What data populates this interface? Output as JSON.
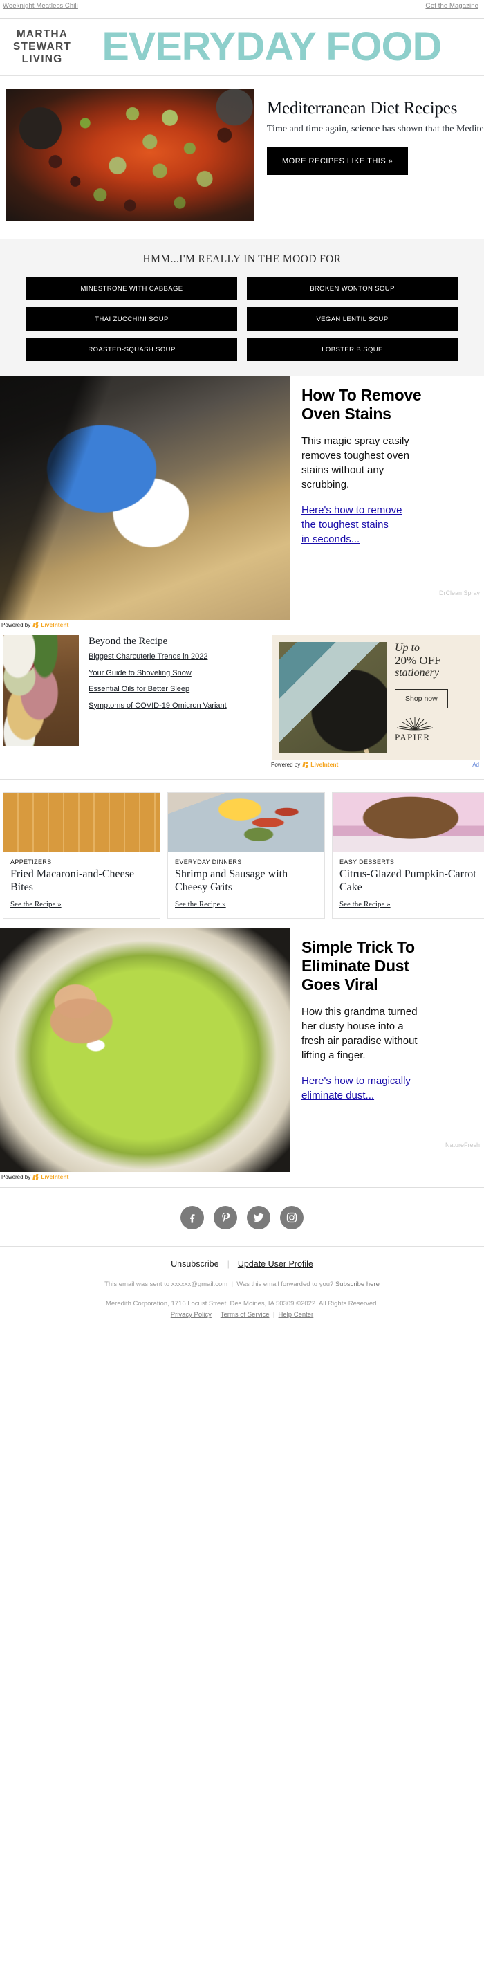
{
  "preheader": {
    "left_link": "Weeknight Meatless Chili",
    "right_link": "Get the Magazine"
  },
  "masthead": {
    "brand_line1": "MARTHA",
    "brand_line2": "STEWART",
    "brand_line3": "LIVING",
    "publication": "EVERYDAY FOOD",
    "accent_color": "#8ecfcb"
  },
  "hero": {
    "title": "Mediterranean Diet Recipes",
    "body": "Time and time again, science has shown that the Mediterranean diet promotes anti-aging and healthy bodies and minds.",
    "cta": "MORE RECIPES LIKE THIS »",
    "image_alt": "Bowl of black bean chili with avocado and cilantro"
  },
  "mood": {
    "heading": "HMM...I'M REALLY IN THE MOOD FOR",
    "buttons": [
      "MINESTRONE WITH CABBAGE",
      "BROKEN WONTON SOUP",
      "THAI ZUCCHINI SOUP",
      "VEGAN LENTIL SOUP",
      "ROASTED-SQUASH SOUP",
      "LOBSTER BISQUE"
    ]
  },
  "sponsored_oven": {
    "title_line1": "How To Remove",
    "title_line2": "Oven Stains",
    "body_line1": "This magic spray easily",
    "body_line2": "removes toughest oven",
    "body_line3": "stains without any",
    "body_line4": "scrubbing.",
    "link_line1": "Here's how to remove",
    "link_line2": "the toughest stains",
    "link_line3": "in seconds...",
    "advertiser": "DrClean Spray",
    "powered_by": "Powered by",
    "network": "LiveIntent",
    "image_alt": "Blue-gloved hand scrubbing an oven with a pink sponge",
    "link_color": "#1a0dab"
  },
  "beyond_recipe": {
    "title": "Beyond the Recipe",
    "links": [
      "Biggest Charcuterie Trends in 2022",
      "Your Guide to Shoveling Snow",
      "Essential Oils for Better Sleep",
      "Symptoms of COVID-19 Omicron Variant"
    ],
    "image_alt": "Charcuterie board with cheese, meats, olives and rosemary"
  },
  "papier_ad": {
    "headline_line1": "Up to",
    "headline_line2": "20% OFF",
    "headline_line3": "stationery",
    "button": "Shop now",
    "brand": "PAPIER",
    "powered_by": "Powered by",
    "network": "LiveIntent",
    "ad_mark": "Ad",
    "image_alt": "Notebooks and pencil on an olive green desk",
    "bg_color": "#f3ece0"
  },
  "recipe_cards": [
    {
      "category": "APPETIZERS",
      "title": "Fried Macaroni-and-Cheese Bites",
      "link": "See the Recipe »",
      "image_alt": "Grid of golden fried macaroni and cheese bites"
    },
    {
      "category": "EVERYDAY DINNERS",
      "title": "Shrimp and Sausage with Cheesy Grits",
      "link": "See the Recipe »",
      "image_alt": "Bowl of shrimp and sausage over cheesy grits"
    },
    {
      "category": "EASY DESSERTS",
      "title": "Citrus-Glazed Pumpkin-Carrot Cake",
      "link": "See the Recipe »",
      "image_alt": "Glazed pumpkin carrot bundt cake on a pink stand"
    }
  ],
  "sponsored_dust": {
    "title_line1": "Simple Trick To",
    "title_line2": "Eliminate Dust",
    "title_line3": "Goes Viral",
    "body_line1": "How this grandma turned",
    "body_line2": "her dusty house into a",
    "body_line3": "fresh air paradise without",
    "body_line4": "lifting a finger.",
    "link_line1": "Here's how to magically",
    "link_line2": "eliminate dust...",
    "advertiser": "NatureFresh",
    "powered_by": "Powered by",
    "network": "LiveIntent",
    "image_alt": "Finger dipping into a bowl of bright green soup",
    "link_color": "#1a0dab"
  },
  "footer": {
    "social": [
      {
        "name": "facebook",
        "label": "Facebook"
      },
      {
        "name": "pinterest",
        "label": "Pinterest"
      },
      {
        "name": "twitter",
        "label": "Twitter"
      },
      {
        "name": "instagram",
        "label": "Instagram"
      }
    ],
    "unsubscribe": "Unsubscribe",
    "update_profile": "Update User Profile",
    "sent_to": "This email was sent to xxxxxx@gmail.com",
    "forwarded": "Was this email forwarded to you?",
    "subscribe_here": "Subscribe here",
    "copyright": "Meredith Corporation, 1716 Locust Street, Des Moines, IA 50309 ©2022. All Rights Reserved.",
    "privacy": "Privacy Policy",
    "terms": "Terms of Service",
    "help": "Help Center"
  }
}
